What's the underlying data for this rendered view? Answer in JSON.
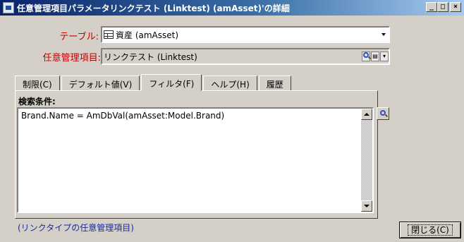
{
  "window": {
    "title": "任意管理項目パラメータリンクテスト (Linktest) (amAsset)'の詳細",
    "min": "_",
    "max": "□",
    "close": "×"
  },
  "form": {
    "table_label": "テーブル:",
    "table_value": "資産 (amAsset)",
    "field_label": "任意管理項目:",
    "field_value": "リンクテスト (Linktest)"
  },
  "tabs": [
    {
      "label": "制限(C)"
    },
    {
      "label": "デフォルト値(V)"
    },
    {
      "label": "フィルタ(F)",
      "active": true
    },
    {
      "label": "ヘルプ(H)"
    },
    {
      "label": "履歴"
    }
  ],
  "filter": {
    "section_label": "検索条件:",
    "expression": "Brand.Name = AmDbVal(amAsset:Model.Brand)"
  },
  "hint": "(リンクタイプの任意管理項目)",
  "buttons": {
    "close": "閉じる(C)"
  },
  "icons": {
    "app": "app-icon",
    "table": "table-icon",
    "search": "magnifier-icon"
  },
  "colors": {
    "label_red": "#c00000",
    "hint_blue": "#1c2aa0",
    "title_blue": "#0a246a"
  }
}
